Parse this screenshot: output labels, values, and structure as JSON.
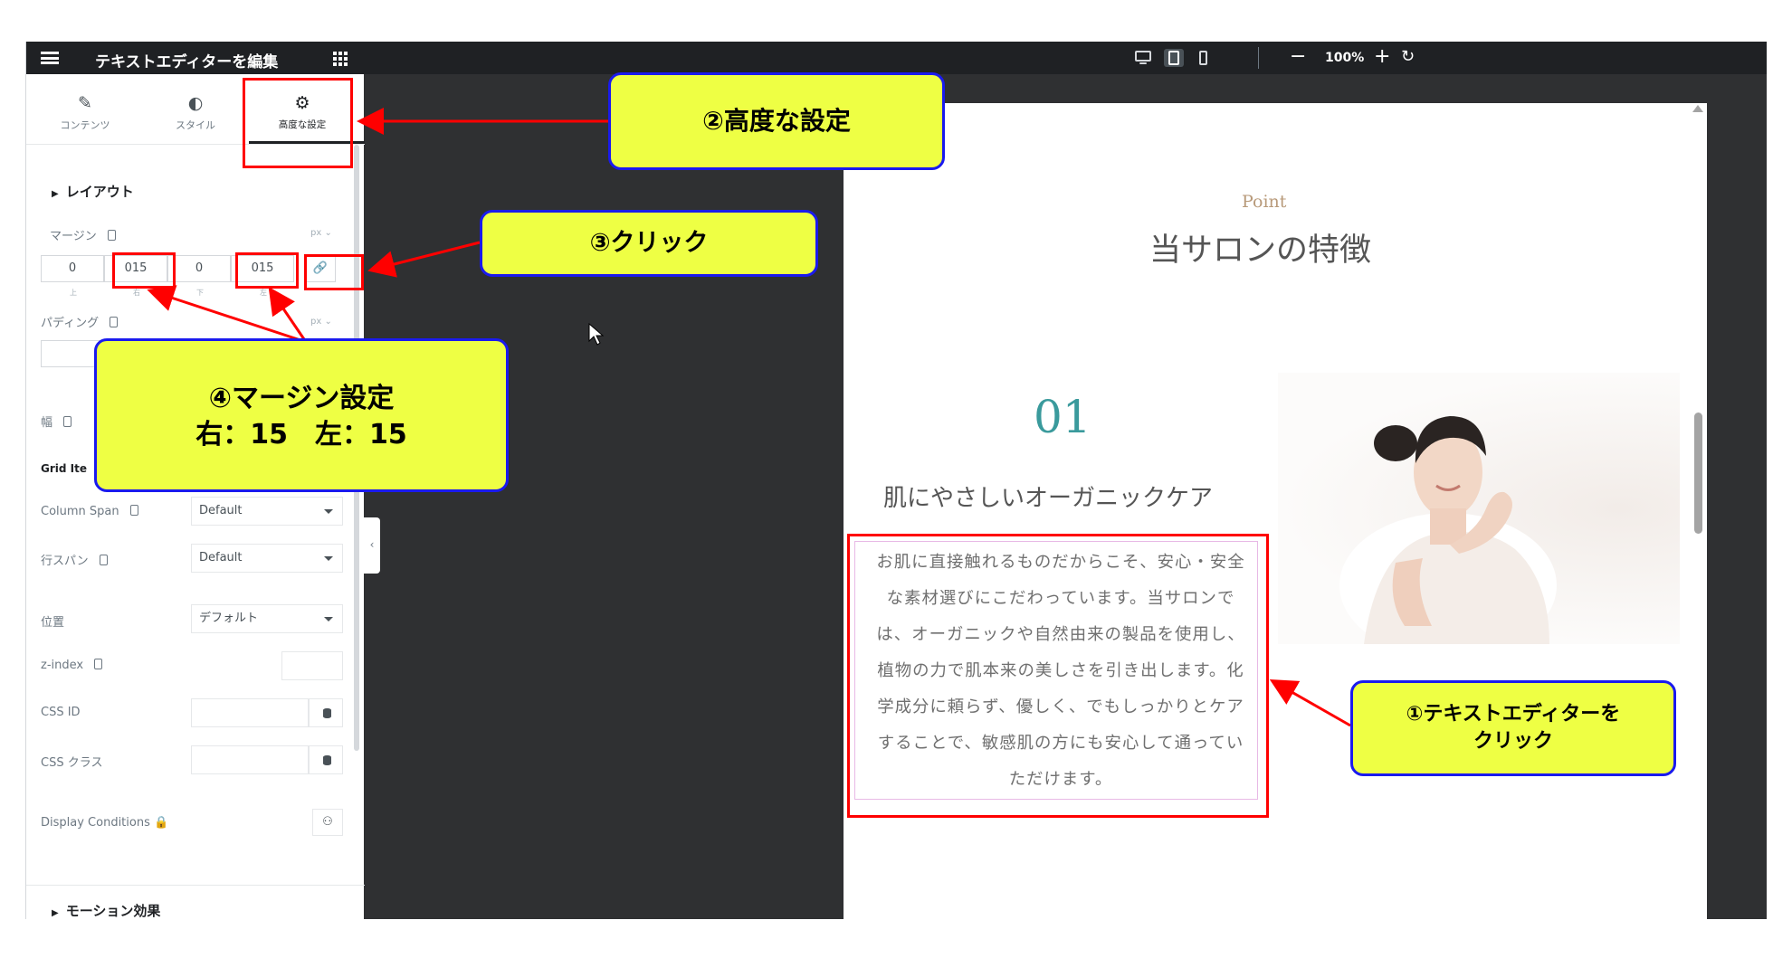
{
  "editor": {
    "title": "テキストエディターを編集",
    "tabs": [
      {
        "label": "コンテンツ",
        "icon": "pencil-icon"
      },
      {
        "label": "スタイル",
        "icon": "contrast-icon"
      },
      {
        "label": "高度な設定",
        "icon": "gear-icon"
      }
    ],
    "layout_section": "レイアウト",
    "margin_label": "マージン",
    "margin_unit": "px",
    "margin_values": [
      "0",
      "015",
      "0",
      "015"
    ],
    "margin_captions": [
      "上",
      "右",
      "下",
      "左"
    ],
    "padding_label": "パディング",
    "padding_unit": "px",
    "width_label": "幅",
    "grid_item_label": "Grid Ite",
    "column_span_label": "Column Span",
    "column_span_value": "Default",
    "row_span_label": "行スパン",
    "row_span_value": "Default",
    "position_label": "位置",
    "position_value": "デフォルト",
    "zindex_label": "z-index",
    "css_id_label": "CSS ID",
    "css_class_label": "CSS クラス",
    "display_conditions_label": "Display Conditions",
    "motion_section": "モーション効果"
  },
  "topbar": {
    "zoom_minus": "−",
    "zoom_level": "100%",
    "zoom_plus": "+",
    "zoom_reset": "↻",
    "devices": [
      "desktop-icon",
      "tablet-icon",
      "mobile-icon"
    ]
  },
  "preview": {
    "point_label": "Point",
    "section_title": "当サロンの特徴",
    "feature_number": "01",
    "feature_heading": "肌にやさしいオーガニックケア",
    "feature_text": "お肌に直接触れるものだからこそ、安心・安全な素材選びにこだわっています。当サロンでは、オーガニックや自然由来の製品を使用し、植物の力で肌本来の美しさを引き出します。化学成分に頼らず、優しく、でもしっかりとケアすることで、敏感肌の方にも安心して通っていただけます。"
  },
  "annotations": {
    "step1": "①テキストエディターを\nクリック",
    "step2": "②高度な設定",
    "step3": "③クリック",
    "step4_line1": "④マージン設定",
    "step4_line2": "右：15　左：15"
  },
  "colors": {
    "callout_fill": "#eeff44",
    "callout_border": "#1a1aee",
    "highlight_red": "#ff0000",
    "accent_teal": "#3a9a9c",
    "editor_dark": "#1f2124",
    "canvas_dark": "#2f3032"
  }
}
